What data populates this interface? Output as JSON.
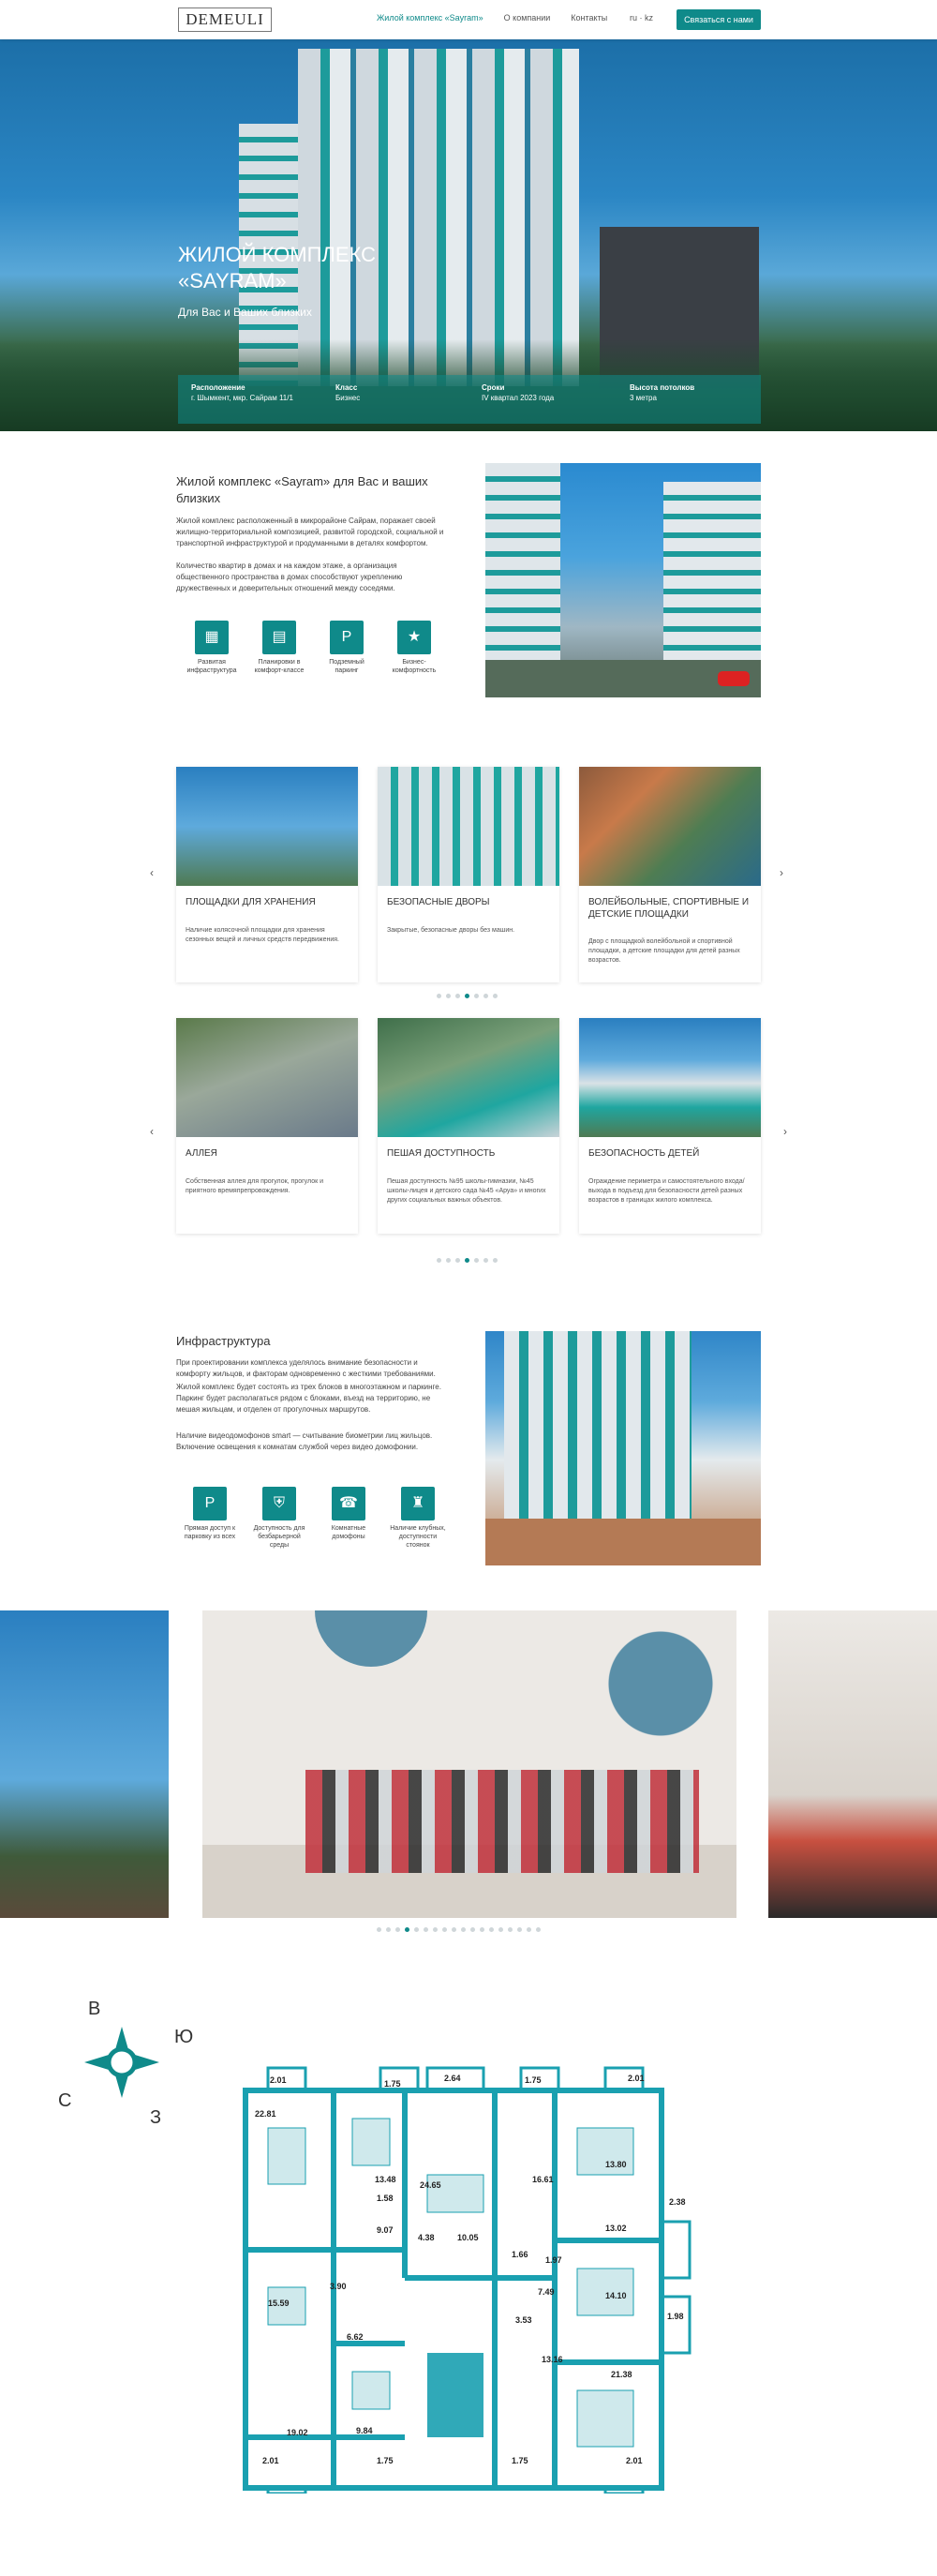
{
  "header": {
    "logo": "DEMEULI",
    "nav": [
      "Жилой комплекс «Sayram»",
      "О компании",
      "Контакты"
    ],
    "lang": "ru · kz",
    "cta": "Связаться с нами",
    "colors": {
      "accent": "#0f8a8a"
    }
  },
  "hero": {
    "title_line1": "ЖИЛОЙ КОМПЛЕКС",
    "title_line2": "«SAYRAM»",
    "subtitle": "Для Вас и Ваших близких",
    "stats": [
      {
        "label": "Расположение",
        "value": "г. Шымкент, мкр. Сайрам 11/1"
      },
      {
        "label": "Класс",
        "value": "Бизнес"
      },
      {
        "label": "Сроки",
        "value": "IV квартал 2023 года"
      },
      {
        "label": "Высота потолков",
        "value": "3 метра"
      }
    ]
  },
  "about": {
    "title": "Жилой комплекс «Sayram» для Вас и ваших близких",
    "p1": "Жилой комплекс расположенный в микрорайоне Сайрам, поражает своей жилищно-территориальной композицией, развитой городской, социальной и транспортной инфраструктурой и продуманными в деталях комфортом.",
    "p2": "Количество квартир в домах и на каждом этаже, а организация общественного пространства в домах способствуют укреплению дружественных и доверительных отношений между соседями.",
    "features": [
      "Развитая инфраструктура",
      "Планировки в комфорт-классе",
      "Подземный паркинг",
      "Бизнес-комфортность"
    ]
  },
  "cards_row1": [
    {
      "title": "ПЛОЩАДКИ ДЛЯ ХРАНЕНИЯ",
      "text": "Наличие колясочной площадки для хранения сезонных вещей и личных средств передвижения."
    },
    {
      "title": "БЕЗОПАСНЫЕ ДВОРЫ",
      "text": "Закрытые, безопасные дворы без машин."
    },
    {
      "title": "ВОЛЕЙБОЛЬНЫЕ, СПОРТИВНЫЕ И ДЕТСКИЕ ПЛОЩАДКИ",
      "text": "Двор с площадкой волейбольной и спортивной площадки, а детские площадки для детей разных возрастов."
    }
  ],
  "cards_row2": [
    {
      "title": "АЛЛЕЯ",
      "text": "Собственная аллея для прогулок, прогулок и приятного времяпрепровождения."
    },
    {
      "title": "ПЕШАЯ ДОСТУПНОСТЬ",
      "text": "Пешая доступность №95 школы-гимназии, №45 школы-лицея и детского сада №45 «Аруа» и многих других социальных важных объектов."
    },
    {
      "title": "БЕЗОПАСНОСТЬ ДЕТЕЙ",
      "text": "Ограждение периметра и самостоятельного входа/выхода в подъезд для безопасности детей разных возрастов в границах жилого комплекса."
    }
  ],
  "infra": {
    "title": "Инфраструктура",
    "p1": "При проектировании комплекса уделялось внимание безопасности и комфорту жильцов, и факторам одновременно с жесткими требованиями.",
    "p2": "Жилой комплекс будет состоять из трех блоков в многоэтажном и паркинге. Паркинг будет располагаться рядом с блоками, въезд на территорию, не мешая жильцам, и отделен от прогулочных маршрутов.",
    "p3": "Наличие видеодомофонов smart — считывание биометрии лиц жильцов. Включение освещения к комнатам службой через видео домофонии.",
    "features": [
      "Прямая доступ к парковку из всех",
      "Доступность для безбарьерной среды",
      "Комнатные домофоны",
      "Наличие клубных, доступности стоянок"
    ]
  },
  "plan": {
    "compass": {
      "n": "В",
      "e": "Ю",
      "s": "З",
      "w": "С"
    },
    "areas": [
      "2.01",
      "1.75",
      "2.64",
      "1.75",
      "2.01",
      "22.81",
      "13.48",
      "24.65",
      "16.61",
      "13.80",
      "1.58",
      "2.38",
      "9.07",
      "4.38",
      "10.05",
      "13.02",
      "1.66",
      "1.97",
      "7.49",
      "3.90",
      "14.10",
      "15.59",
      "1.98",
      "6.62",
      "3.53",
      "13.16",
      "21.38",
      "19.02",
      "9.84",
      "2.01",
      "1.75",
      "1.75",
      "2.01"
    ]
  }
}
